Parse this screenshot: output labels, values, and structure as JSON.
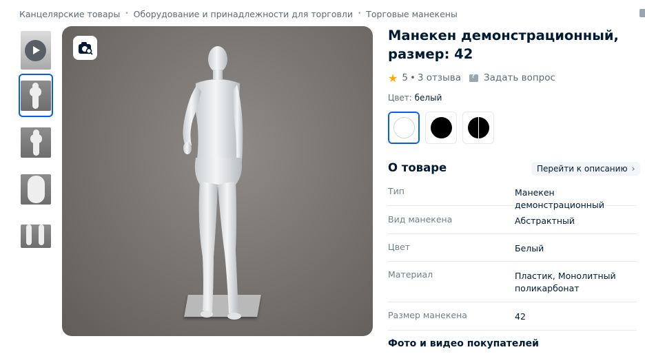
{
  "breadcrumb": [
    "Канцелярские товары",
    "Оборудование и принадлежности для торговли",
    "Торговые манекены"
  ],
  "gallery": {
    "thumbnails": [
      {
        "kind": "video",
        "icon": "play-icon"
      },
      {
        "kind": "photo",
        "active": true
      },
      {
        "kind": "photo",
        "active": false
      },
      {
        "kind": "photo",
        "active": false
      },
      {
        "kind": "photo",
        "active": false
      }
    ],
    "photo_search_icon": "camera-search-icon"
  },
  "product": {
    "title_line1": "Манекен демонстрационный,",
    "title_line2": "размер: 42",
    "rating": "5",
    "reviews": "3 отзыва",
    "ask_question": "Задать вопрос",
    "color_label": "Цвет:",
    "color_value": "белый",
    "swatches": [
      {
        "name": "white",
        "color": "#ffffff",
        "selected": true
      },
      {
        "name": "black",
        "color": "#000000",
        "selected": false
      },
      {
        "name": "black-white",
        "color": "#000000",
        "selected": false
      }
    ]
  },
  "about": {
    "title": "О товаре",
    "goto_label": "Перейти к описанию",
    "specs": [
      {
        "key": "Тип",
        "value": "Манекен демонстрационный"
      },
      {
        "key": "Вид манекена",
        "value": "Абстрактный"
      },
      {
        "key": "Цвет",
        "value": "Белый"
      },
      {
        "key": "Материал",
        "value": "Пластик, Монолитный поликарбонат"
      },
      {
        "key": "Размер манекена",
        "value": "42"
      }
    ]
  },
  "photos_section_title": "Фото и видео покупателей",
  "colors": {
    "accent": "#005bff",
    "text": "#001a34",
    "muted": "#707f8d",
    "star": "#ffa800"
  }
}
